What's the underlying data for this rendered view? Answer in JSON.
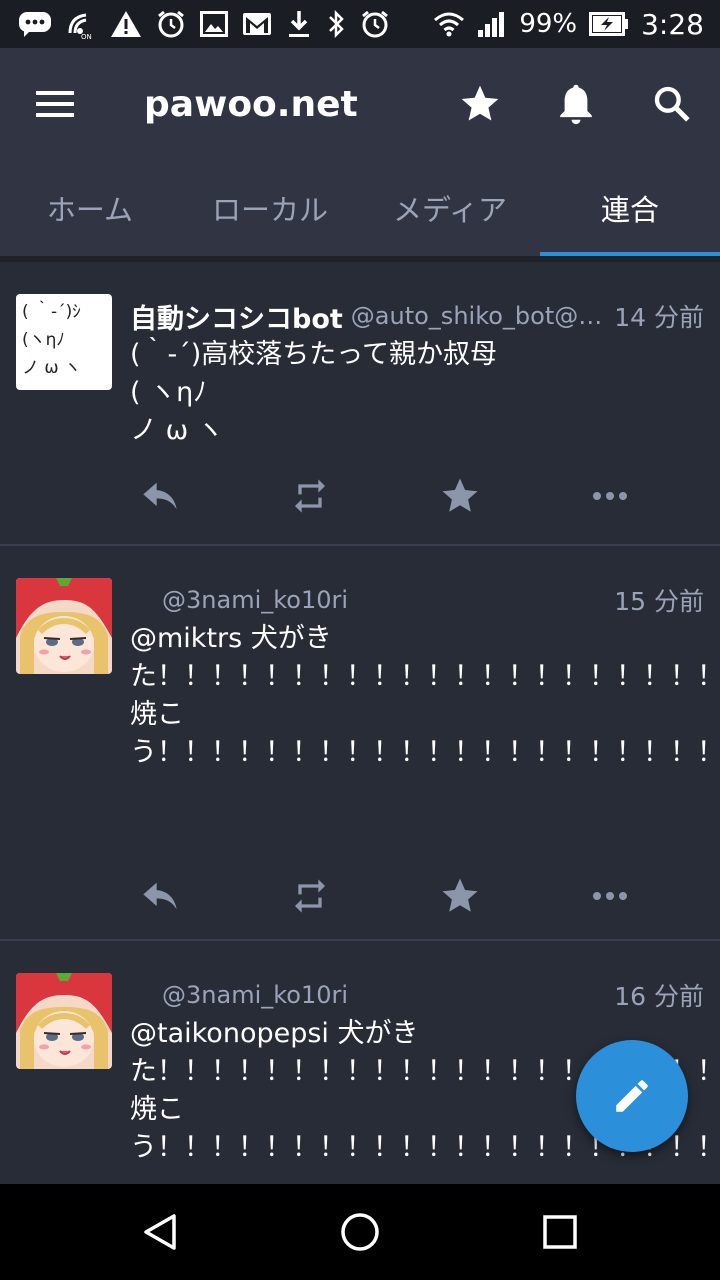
{
  "status_bar": {
    "battery": "99%",
    "time": "3:28"
  },
  "app_bar": {
    "title": "pawoo.net"
  },
  "tabs": [
    {
      "label": "ホーム",
      "active": false
    },
    {
      "label": "ローカル",
      "active": false
    },
    {
      "label": "メディア",
      "active": false
    },
    {
      "label": "連合",
      "active": true
    }
  ],
  "statuses": [
    {
      "display_name": "自動シコシコbot",
      "acct": "@auto_shiko_bot@mst...",
      "time": "14 分前",
      "content": "(｀-´)高校落ちたって親か叔母\n( ヽηﾉ\nノ ω ヽ",
      "avatar_text": "( ｀-´)ｼ\n(ヽηﾉ\nノ ω ヽ"
    },
    {
      "display_name": "",
      "acct": "@3nami_ko10ri",
      "time": "15 分前",
      "content": "@miktrs 犬がきた！！！！！！！！！！！！！！！！！！！！！！！！！！！！！！！！！！！！！！！！！！！！！！焼こう！！！！！！！！！！！！！！！！！！！！！！！！！！！！！！！！！！！！！！！！！！！"
    },
    {
      "display_name": "",
      "acct": "@3nami_ko10ri",
      "time": "16 分前",
      "content": "@taikonopepsi 犬がきた！！！！！！！！！！！！！！！！！！！！！！！！！！！！！！！！！！！！！！！！！！！焼こう！！！！！！！！！！！！！！！！！！！！！！！！！！！！！！！！！！！！！"
    }
  ],
  "colors": {
    "background": "#282c37",
    "app_bar": "#313543",
    "accent": "#2b90d9",
    "muted_text": "#9ba3b8"
  },
  "icons": [
    "menu-icon",
    "star-icon",
    "bell-icon",
    "search-icon",
    "reply-icon",
    "boost-icon",
    "favourite-icon",
    "more-icon",
    "compose-icon",
    "back-icon",
    "home-icon",
    "recents-icon"
  ]
}
